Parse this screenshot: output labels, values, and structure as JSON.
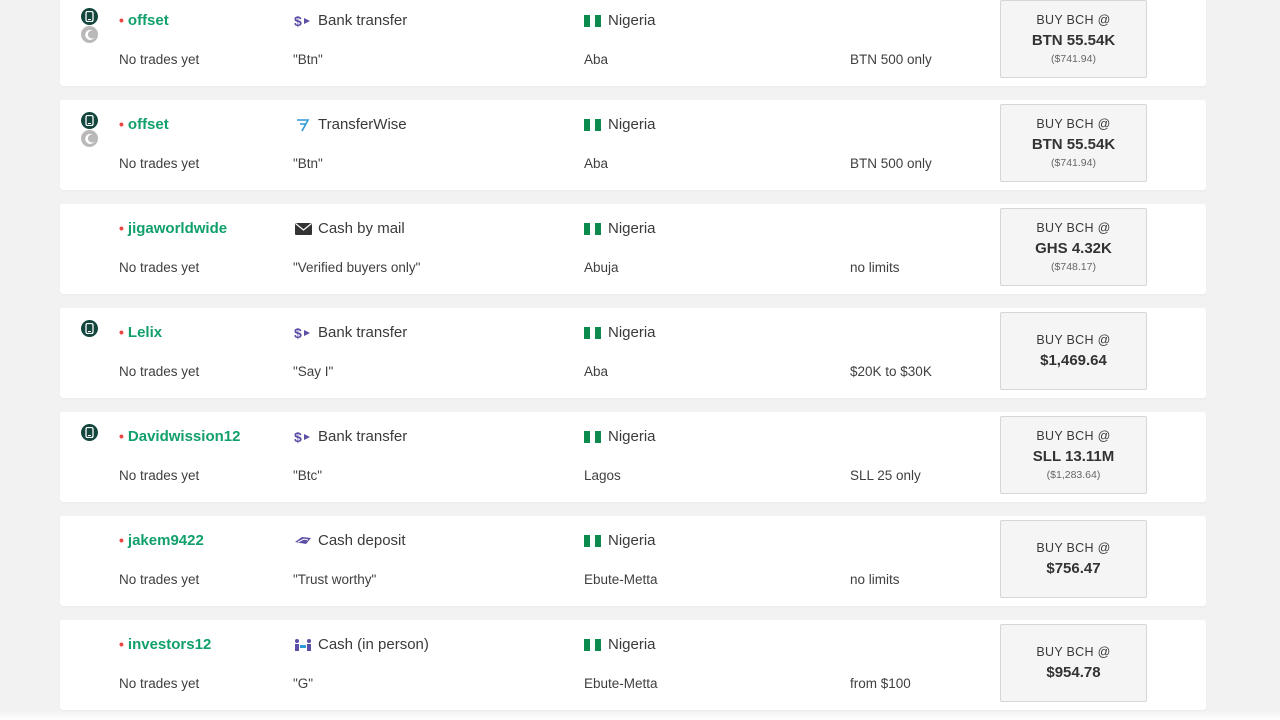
{
  "buy_label": "BUY BCH @",
  "colors": {
    "accent_green": "#11a06a",
    "dot_red": "#e8453c",
    "phone_badge": "#14463f"
  },
  "offers": [
    {
      "user": "offset",
      "status_icons": [
        "phone-icon",
        "moon-icon"
      ],
      "trades": "No trades yet",
      "method": "Bank transfer",
      "method_icon": "bank-transfer-icon",
      "message": "\"Btn\"",
      "country": "Nigeria",
      "city": "Aba",
      "limits": "BTN 500 only",
      "price": "BTN 55.54K",
      "usd": "($741.94)"
    },
    {
      "user": "offset",
      "status_icons": [
        "phone-icon",
        "moon-icon"
      ],
      "trades": "No trades yet",
      "method": "TransferWise",
      "method_icon": "transferwise-icon",
      "message": "\"Btn\"",
      "country": "Nigeria",
      "city": "Aba",
      "limits": "BTN 500 only",
      "price": "BTN 55.54K",
      "usd": "($741.94)"
    },
    {
      "user": "jigaworldwide",
      "status_icons": [],
      "trades": "No trades yet",
      "method": "Cash by mail",
      "method_icon": "mail-icon",
      "message": "\"Verified buyers only\"",
      "country": "Nigeria",
      "city": "Abuja",
      "limits": "no limits",
      "price": "GHS 4.32K",
      "usd": "($748.17)"
    },
    {
      "user": "Lelix",
      "status_icons": [
        "phone-icon"
      ],
      "trades": "No trades yet",
      "method": "Bank transfer",
      "method_icon": "bank-transfer-icon",
      "message": "\"Say I\"",
      "country": "Nigeria",
      "city": "Aba",
      "limits": "$20K to $30K",
      "price": "$1,469.64",
      "usd": ""
    },
    {
      "user": "Davidwission12",
      "status_icons": [
        "phone-icon"
      ],
      "trades": "No trades yet",
      "method": "Bank transfer",
      "method_icon": "bank-transfer-icon",
      "message": "\"Btc\"",
      "country": "Nigeria",
      "city": "Lagos",
      "limits": "SLL 25 only",
      "price": "SLL 13.11M",
      "usd": "($1,283.64)"
    },
    {
      "user": "jakem9422",
      "status_icons": [],
      "trades": "No trades yet",
      "method": "Cash deposit",
      "method_icon": "cash-deposit-icon",
      "message": "\"Trust worthy\"",
      "country": "Nigeria",
      "city": "Ebute-Metta",
      "limits": "no limits",
      "price": "$756.47",
      "usd": ""
    },
    {
      "user": "investors12",
      "status_icons": [],
      "trades": "No trades yet",
      "method": "Cash (in person)",
      "method_icon": "cash-in-person-icon",
      "message": "\"G\"",
      "country": "Nigeria",
      "city": "Ebute-Metta",
      "limits": "from $100",
      "price": "$954.78",
      "usd": ""
    }
  ]
}
